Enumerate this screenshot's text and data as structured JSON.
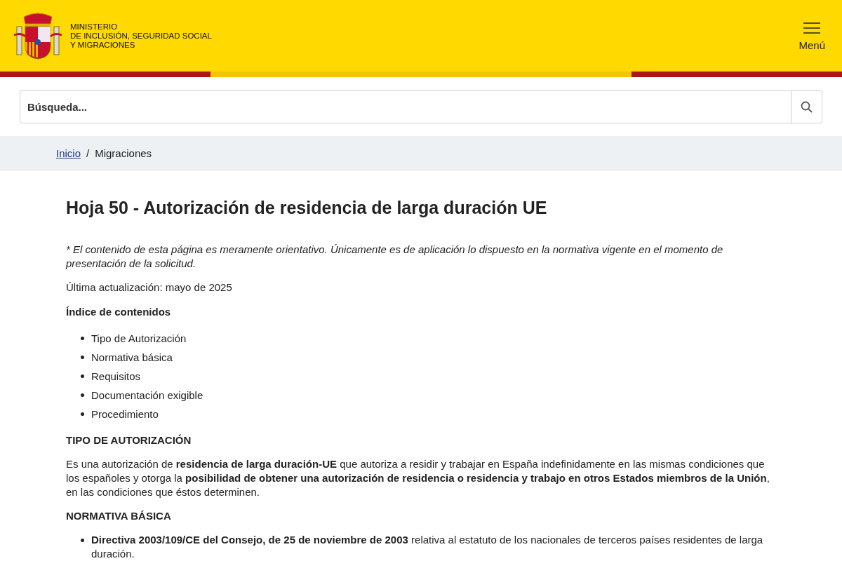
{
  "header": {
    "ministry_lines": [
      "MINISTERIO",
      "DE INCLUSIÓN, SEGURIDAD SOCIAL",
      "Y MIGRACIONES"
    ],
    "menu_label": "Menú"
  },
  "search": {
    "placeholder": "Búsqueda..."
  },
  "breadcrumb": [
    {
      "label": "Inicio",
      "kind": "link"
    },
    {
      "label": "Migraciones",
      "kind": "current"
    }
  ],
  "breadcrumb_separator": "/",
  "title": "Hoja 50 - Autorización de residencia de larga duración UE",
  "disclaimer": "* El contenido de esta página es meramente orientativo. Únicamente es de aplicación lo dispuesto en la normativa vigente en el momento de presentación de la solicitud.",
  "updated": "Última actualización: mayo de 2025",
  "index_heading": "Índice de contenidos",
  "index_items": [
    "Tipo de Autorización",
    "Normativa básica",
    "Requisitos",
    "Documentación exigible",
    "Procedimiento"
  ],
  "sections": [
    {
      "heading": "TIPO DE AUTORIZACIÓN",
      "kind": "paragraph",
      "text": "Es una autorización de **residencia de larga duración-UE** que autoriza a residir y trabajar en España indefinidamente en las mismas condiciones que los españoles y otorga la **posibilidad de obtener una autorización de residencia o residencia y trabajo en otros Estados miembros de la Unión**, en las condiciones que éstos determinen."
    },
    {
      "heading": "NORMATIVA BÁSICA",
      "kind": "list",
      "items": [
        "**Directiva 2003/109/CE del Consejo, de 25 de noviembre de 2003** relativa al estatuto de los nacionales de terceros países residentes de larga duración."
      ]
    }
  ]
}
